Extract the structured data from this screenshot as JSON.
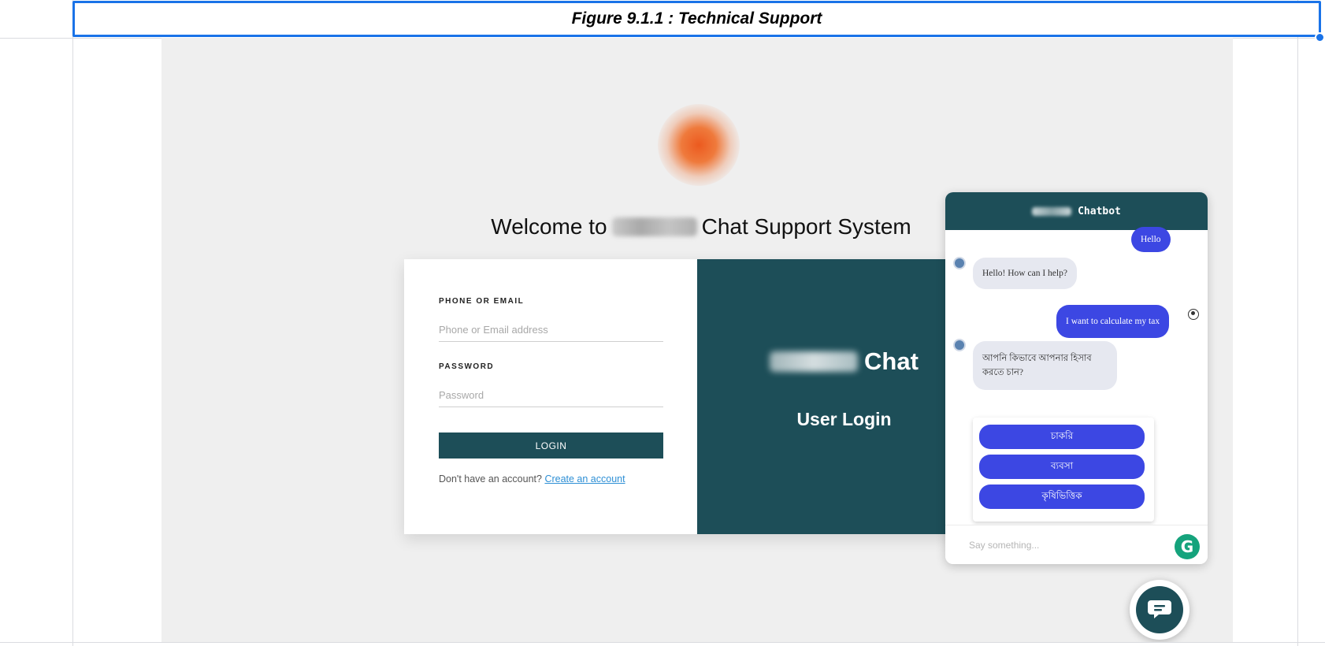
{
  "caption": "Figure 9.1.1 : Technical Support",
  "page": {
    "welcome_prefix": "Welcome to",
    "welcome_suffix": "Chat Support System"
  },
  "login_form": {
    "phone_label": "PHONE OR EMAIL",
    "phone_placeholder": "Phone or Email address",
    "password_label": "PASSWORD",
    "password_placeholder": "Password",
    "login_button": "LOGIN",
    "signup_prompt": "Don't have an account?",
    "signup_link": "Create an account"
  },
  "brand_panel": {
    "chat_word": "Chat",
    "subtitle": "User Login"
  },
  "chatbot": {
    "title": "Chatbot",
    "messages": [
      {
        "from": "user",
        "text": "Hello"
      },
      {
        "from": "bot",
        "text": "Hello! How can I help?"
      },
      {
        "from": "user",
        "text": "I want to calculate my tax"
      },
      {
        "from": "bot",
        "text": "আপনি কিভাবে আপনার হিসাব করতে চান?"
      }
    ],
    "quick_replies": [
      "চাকরি",
      "ব্যবসা",
      "কৃষিভিত্তিক"
    ],
    "input_placeholder": "Say something...",
    "grammarly_letter": "G"
  },
  "colors": {
    "brand_teal": "#1d4e58",
    "bubble_user": "#3c47e3",
    "selection_blue": "#1a73e8"
  },
  "icons": [
    "grammarly-icon",
    "chat-bubble-icon",
    "bot-avatar-icon",
    "user-avatar-icon"
  ]
}
